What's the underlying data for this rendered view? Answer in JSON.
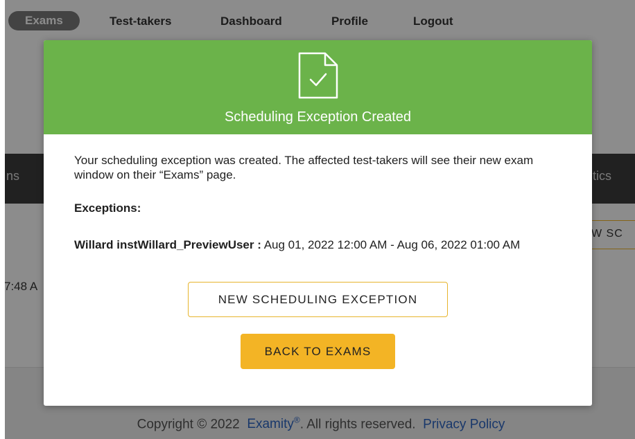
{
  "nav": {
    "items": [
      "Exams",
      "Test-takers",
      "Dashboard",
      "Profile",
      "Logout"
    ],
    "active": "Exams"
  },
  "background": {
    "tab_fragment_left": "ns",
    "tab_fragment_right": "tics",
    "row_button_fragment": "W SC",
    "row_time_fragment": "7:48 A"
  },
  "footer": {
    "copyright": "Copyright © 2022",
    "brand": "Examity",
    "brand_mark": "®",
    "rights": ". All rights reserved.",
    "privacy": "Privacy Policy"
  },
  "modal": {
    "title": "Scheduling Exception Created",
    "message": "Your scheduling exception was created. The affected test-takers will see their new exam window on their “Exams” page.",
    "exceptions_label": "Exceptions:",
    "exception": {
      "user": "Willard instWillard_PreviewUser :",
      "window": "Aug 01, 2022 12:00 AM - Aug 06, 2022 01:00 AM"
    },
    "new_button": "NEW SCHEDULING EXCEPTION",
    "back_button": "BACK TO EXAMS",
    "header_color": "#6bb34a",
    "accent_color": "#f3b425",
    "header_icon": "document-check-icon"
  }
}
